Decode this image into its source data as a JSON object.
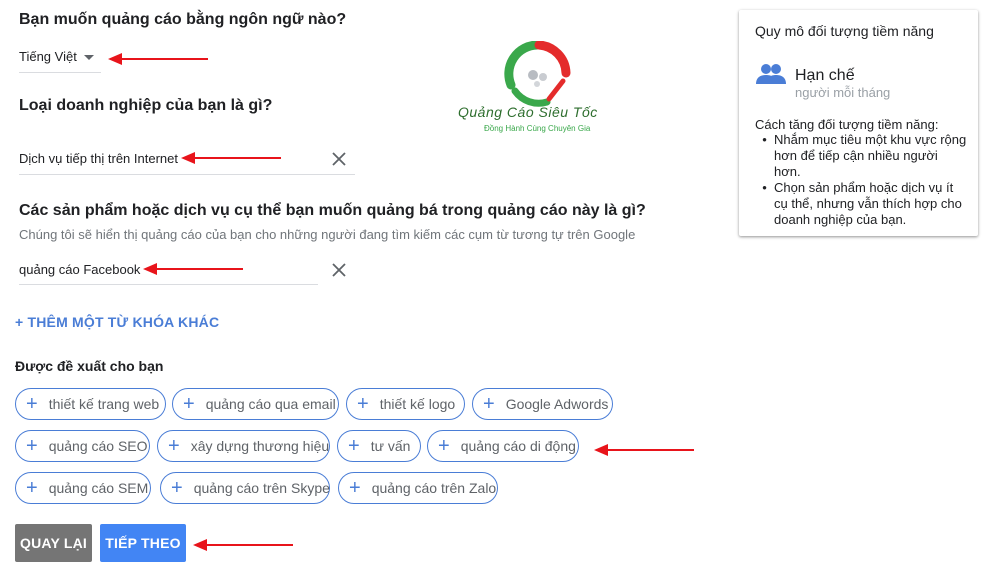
{
  "language": {
    "question": "Bạn muốn quảng cáo bằng ngôn ngữ nào?",
    "selected": "Tiếng Việt"
  },
  "business": {
    "question": "Loại doanh nghiệp của bạn là gì?",
    "value": "Dịch vụ tiếp thị trên Internet"
  },
  "products": {
    "question": "Các sản phẩm hoặc dịch vụ cụ thể bạn muốn quảng bá trong quảng cáo này là gì?",
    "hint": "Chúng tôi sẽ hiển thị quảng cáo của bạn cho những người đang tìm kiếm các cụm từ tương tự trên Google",
    "keyword": "quảng cáo Facebook",
    "add_keyword_label": "+ THÊM MỘT TỪ KHÓA KHÁC"
  },
  "logo": {
    "name": "Quảng Cáo Siêu Tốc",
    "tagline": "Đồng Hành Cùng Chuyên Gia"
  },
  "suggestions": {
    "title": "Được đề xuất cho bạn",
    "chips": [
      "thiết kế trang web",
      "quảng cáo qua email",
      "thiết kế logo",
      "Google Adwords",
      "quảng cáo SEO",
      "xây dựng thương hiệu",
      "tư vấn",
      "quảng cáo di động",
      "quảng cáo SEM",
      "quảng cáo trên Skype",
      "quảng cáo trên Zalo"
    ]
  },
  "buttons": {
    "back": "QUAY LẠI",
    "next": "TIẾP THEO"
  },
  "audience_card": {
    "title": "Quy mô đối tượng tiềm năng",
    "level": "Hạn chế",
    "level_sub": "người mỗi tháng",
    "how_title": "Cách tăng đối tượng tiềm năng:",
    "tips": [
      "Nhắm mục tiêu một khu vực rộng hơn để tiếp cận nhiều người hơn.",
      "Chọn sản phẩm hoặc dịch vụ ít cụ thể, nhưng vẫn thích hợp cho doanh nghiệp của bạn."
    ]
  },
  "colors": {
    "accent_blue": "#4a7dd6",
    "next_button": "#4285f4",
    "back_button": "#757575",
    "annotation_arrow": "#e8141b",
    "logo_green": "#3aa84b",
    "logo_red": "#e42b2b"
  },
  "icons": {
    "dropdown": "triangle-down-icon",
    "clear": "close-icon",
    "chip_add": "plus-icon",
    "audience": "people-icon"
  }
}
